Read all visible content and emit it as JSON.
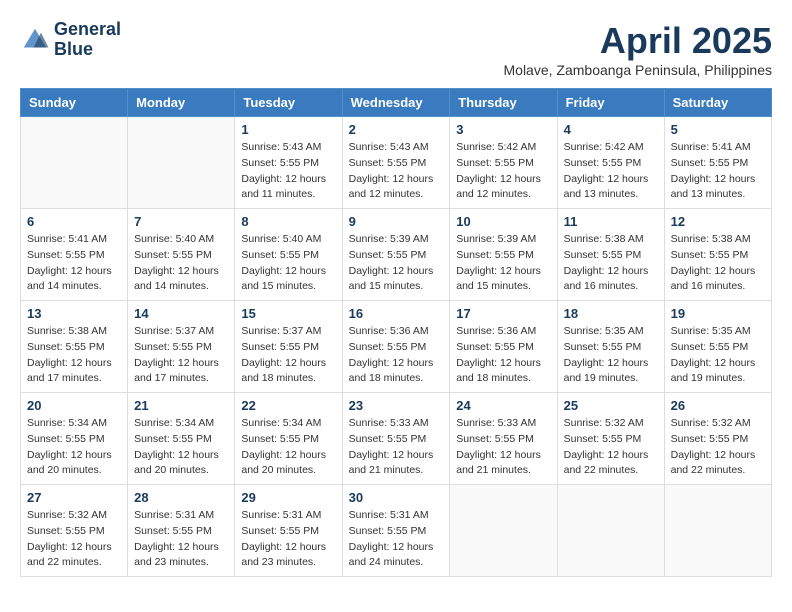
{
  "header": {
    "logo_line1": "General",
    "logo_line2": "Blue",
    "month": "April 2025",
    "location": "Molave, Zamboanga Peninsula, Philippines"
  },
  "days_of_week": [
    "Sunday",
    "Monday",
    "Tuesday",
    "Wednesday",
    "Thursday",
    "Friday",
    "Saturday"
  ],
  "weeks": [
    [
      {
        "day": "",
        "info": ""
      },
      {
        "day": "",
        "info": ""
      },
      {
        "day": "1",
        "info": "Sunrise: 5:43 AM\nSunset: 5:55 PM\nDaylight: 12 hours\nand 11 minutes."
      },
      {
        "day": "2",
        "info": "Sunrise: 5:43 AM\nSunset: 5:55 PM\nDaylight: 12 hours\nand 12 minutes."
      },
      {
        "day": "3",
        "info": "Sunrise: 5:42 AM\nSunset: 5:55 PM\nDaylight: 12 hours\nand 12 minutes."
      },
      {
        "day": "4",
        "info": "Sunrise: 5:42 AM\nSunset: 5:55 PM\nDaylight: 12 hours\nand 13 minutes."
      },
      {
        "day": "5",
        "info": "Sunrise: 5:41 AM\nSunset: 5:55 PM\nDaylight: 12 hours\nand 13 minutes."
      }
    ],
    [
      {
        "day": "6",
        "info": "Sunrise: 5:41 AM\nSunset: 5:55 PM\nDaylight: 12 hours\nand 14 minutes."
      },
      {
        "day": "7",
        "info": "Sunrise: 5:40 AM\nSunset: 5:55 PM\nDaylight: 12 hours\nand 14 minutes."
      },
      {
        "day": "8",
        "info": "Sunrise: 5:40 AM\nSunset: 5:55 PM\nDaylight: 12 hours\nand 15 minutes."
      },
      {
        "day": "9",
        "info": "Sunrise: 5:39 AM\nSunset: 5:55 PM\nDaylight: 12 hours\nand 15 minutes."
      },
      {
        "day": "10",
        "info": "Sunrise: 5:39 AM\nSunset: 5:55 PM\nDaylight: 12 hours\nand 15 minutes."
      },
      {
        "day": "11",
        "info": "Sunrise: 5:38 AM\nSunset: 5:55 PM\nDaylight: 12 hours\nand 16 minutes."
      },
      {
        "day": "12",
        "info": "Sunrise: 5:38 AM\nSunset: 5:55 PM\nDaylight: 12 hours\nand 16 minutes."
      }
    ],
    [
      {
        "day": "13",
        "info": "Sunrise: 5:38 AM\nSunset: 5:55 PM\nDaylight: 12 hours\nand 17 minutes."
      },
      {
        "day": "14",
        "info": "Sunrise: 5:37 AM\nSunset: 5:55 PM\nDaylight: 12 hours\nand 17 minutes."
      },
      {
        "day": "15",
        "info": "Sunrise: 5:37 AM\nSunset: 5:55 PM\nDaylight: 12 hours\nand 18 minutes."
      },
      {
        "day": "16",
        "info": "Sunrise: 5:36 AM\nSunset: 5:55 PM\nDaylight: 12 hours\nand 18 minutes."
      },
      {
        "day": "17",
        "info": "Sunrise: 5:36 AM\nSunset: 5:55 PM\nDaylight: 12 hours\nand 18 minutes."
      },
      {
        "day": "18",
        "info": "Sunrise: 5:35 AM\nSunset: 5:55 PM\nDaylight: 12 hours\nand 19 minutes."
      },
      {
        "day": "19",
        "info": "Sunrise: 5:35 AM\nSunset: 5:55 PM\nDaylight: 12 hours\nand 19 minutes."
      }
    ],
    [
      {
        "day": "20",
        "info": "Sunrise: 5:34 AM\nSunset: 5:55 PM\nDaylight: 12 hours\nand 20 minutes."
      },
      {
        "day": "21",
        "info": "Sunrise: 5:34 AM\nSunset: 5:55 PM\nDaylight: 12 hours\nand 20 minutes."
      },
      {
        "day": "22",
        "info": "Sunrise: 5:34 AM\nSunset: 5:55 PM\nDaylight: 12 hours\nand 20 minutes."
      },
      {
        "day": "23",
        "info": "Sunrise: 5:33 AM\nSunset: 5:55 PM\nDaylight: 12 hours\nand 21 minutes."
      },
      {
        "day": "24",
        "info": "Sunrise: 5:33 AM\nSunset: 5:55 PM\nDaylight: 12 hours\nand 21 minutes."
      },
      {
        "day": "25",
        "info": "Sunrise: 5:32 AM\nSunset: 5:55 PM\nDaylight: 12 hours\nand 22 minutes."
      },
      {
        "day": "26",
        "info": "Sunrise: 5:32 AM\nSunset: 5:55 PM\nDaylight: 12 hours\nand 22 minutes."
      }
    ],
    [
      {
        "day": "27",
        "info": "Sunrise: 5:32 AM\nSunset: 5:55 PM\nDaylight: 12 hours\nand 22 minutes."
      },
      {
        "day": "28",
        "info": "Sunrise: 5:31 AM\nSunset: 5:55 PM\nDaylight: 12 hours\nand 23 minutes."
      },
      {
        "day": "29",
        "info": "Sunrise: 5:31 AM\nSunset: 5:55 PM\nDaylight: 12 hours\nand 23 minutes."
      },
      {
        "day": "30",
        "info": "Sunrise: 5:31 AM\nSunset: 5:55 PM\nDaylight: 12 hours\nand 24 minutes."
      },
      {
        "day": "",
        "info": ""
      },
      {
        "day": "",
        "info": ""
      },
      {
        "day": "",
        "info": ""
      }
    ]
  ]
}
